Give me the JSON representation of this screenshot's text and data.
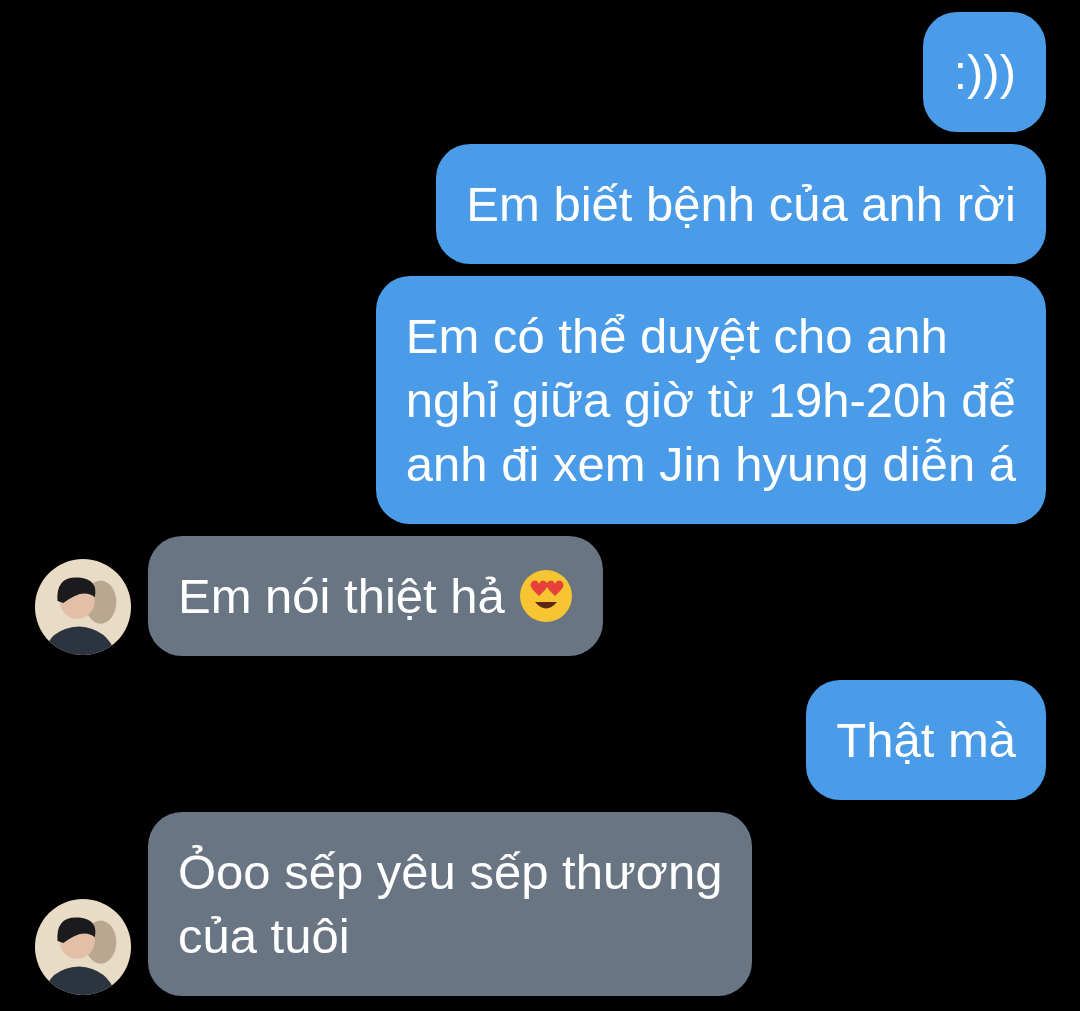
{
  "messages": [
    {
      "kind": "outgoing",
      "text": ":)))"
    },
    {
      "kind": "outgoing",
      "text": "Em biết bệnh của anh rời"
    },
    {
      "kind": "outgoing",
      "text": "Em có thể duyệt cho anh\nnghỉ giữa giờ từ 19h-20h để\nanh đi xem Jin hyung diễn á"
    },
    {
      "kind": "incoming",
      "text": "Em nói thiệt hả",
      "emoji": true
    },
    {
      "kind": "outgoing",
      "text": "Thật mà"
    },
    {
      "kind": "incoming",
      "text": "Ỏoo sếp yêu sếp thương\ncủa tuôi"
    }
  ]
}
